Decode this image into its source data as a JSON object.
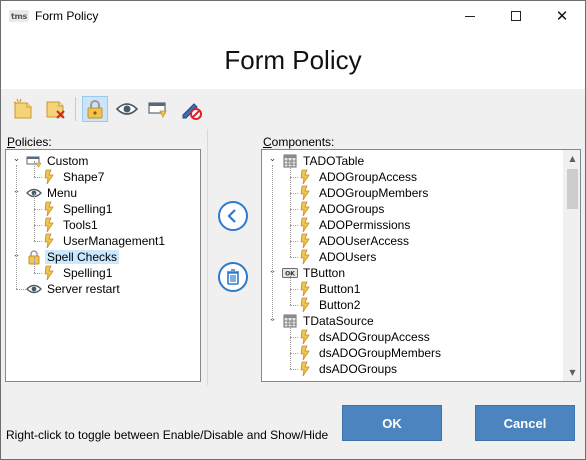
{
  "window": {
    "app_icon": "tms",
    "title": "Form Policy"
  },
  "header": {
    "title": "Form Policy"
  },
  "toolbar": {
    "buttons": [
      {
        "icon": "new-policy-icon"
      },
      {
        "icon": "delete-policy-icon"
      },
      {
        "icon": "enable-lock-icon",
        "active": true
      },
      {
        "icon": "visibility-eye-icon"
      },
      {
        "icon": "form-window-icon"
      },
      {
        "icon": "edit-disable-icon"
      }
    ]
  },
  "policies": {
    "label_prefix": "P",
    "label_rest": "olicies:",
    "items": [
      {
        "label": "Custom",
        "icon": "custom-icon",
        "level": 0,
        "expanded": true
      },
      {
        "label": "Shape7",
        "icon": "lightning-icon",
        "level": 1
      },
      {
        "label": "Menu",
        "icon": "eye-icon",
        "level": 0,
        "expanded": true
      },
      {
        "label": "Spelling1",
        "icon": "lightning-icon",
        "level": 1
      },
      {
        "label": "Tools1",
        "icon": "lightning-icon",
        "level": 1
      },
      {
        "label": "UserManagement1",
        "icon": "lightning-icon",
        "level": 1
      },
      {
        "label": "Spell Checks",
        "icon": "lock-icon",
        "level": 0,
        "expanded": true,
        "selected": true
      },
      {
        "label": "Spelling1",
        "icon": "lightning-icon",
        "level": 1
      },
      {
        "label": "Server restart",
        "icon": "eye-icon",
        "level": 0
      }
    ]
  },
  "components": {
    "label_prefix": "C",
    "label_rest": "omponents:",
    "items": [
      {
        "label": "TADOTable",
        "icon": "table-icon",
        "level": 0,
        "expanded": true
      },
      {
        "label": "ADOGroupAccess",
        "icon": "lightning-icon",
        "level": 1
      },
      {
        "label": "ADOGroupMembers",
        "icon": "lightning-icon",
        "level": 1
      },
      {
        "label": "ADOGroups",
        "icon": "lightning-icon",
        "level": 1
      },
      {
        "label": "ADOPermissions",
        "icon": "lightning-icon",
        "level": 1
      },
      {
        "label": "ADOUserAccess",
        "icon": "lightning-icon",
        "level": 1
      },
      {
        "label": "ADOUsers",
        "icon": "lightning-icon",
        "level": 1
      },
      {
        "label": "TButton",
        "icon": "ok-button-icon",
        "level": 0,
        "expanded": true
      },
      {
        "label": "Button1",
        "icon": "lightning-icon",
        "level": 1
      },
      {
        "label": "Button2",
        "icon": "lightning-icon",
        "level": 1
      },
      {
        "label": "TDataSource",
        "icon": "table-icon",
        "level": 0,
        "expanded": true
      },
      {
        "label": "dsADOGroupAccess",
        "icon": "lightning-icon",
        "level": 1
      },
      {
        "label": "dsADOGroupMembers",
        "icon": "lightning-icon",
        "level": 1
      },
      {
        "label": "dsADOGroups",
        "icon": "lightning-icon",
        "level": 1
      }
    ]
  },
  "middle": {
    "back_icon": "arrow-left-icon",
    "trash_icon": "trash-icon"
  },
  "footer": {
    "hint": "Right-click to toggle between Enable/Disable and Show/Hide",
    "ok_label": "OK",
    "cancel_label": "Cancel"
  },
  "colors": {
    "accent": "#2f7ac8",
    "button": "#4c84bf",
    "selection": "#cce8ff"
  }
}
